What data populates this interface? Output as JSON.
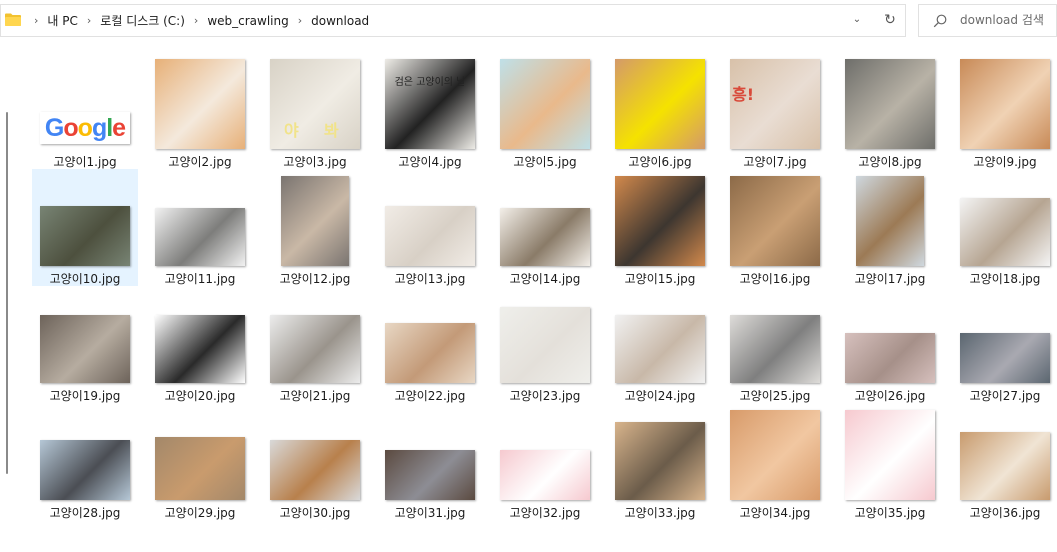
{
  "address": {
    "breadcrumb": [
      "내 PC",
      "로컬 디스크 (C:)",
      "web_crawling",
      "download"
    ]
  },
  "search": {
    "placeholder": "download 검색"
  },
  "files": [
    {
      "name": "고양이1.jpg",
      "kind": "google-logo",
      "logo_text": "Google"
    },
    {
      "name": "고양이2.jpg",
      "colors": [
        "#e7b078",
        "#f4e9dc"
      ]
    },
    {
      "name": "고양이3.jpg",
      "colors": [
        "#d8d2c6",
        "#f0ece4"
      ],
      "overlay": [
        "야",
        "봐"
      ]
    },
    {
      "name": "고양이4.jpg",
      "colors": [
        "#eeece7",
        "#222222"
      ],
      "book_title": "검은 고양이의 날"
    },
    {
      "name": "고양이5.jpg",
      "colors": [
        "#bfe0e8",
        "#e9b98b"
      ]
    },
    {
      "name": "고양이6.jpg",
      "colors": [
        "#d49a69",
        "#f5e200"
      ]
    },
    {
      "name": "고양이7.jpg",
      "colors": [
        "#d8c1a9",
        "#e9ddd3"
      ],
      "overlay": [
        "흥!"
      ]
    },
    {
      "name": "고양이8.jpg",
      "colors": [
        "#6e6e6a",
        "#b8b2a6"
      ]
    },
    {
      "name": "고양이9.jpg",
      "colors": [
        "#c88a57",
        "#f0d2b4"
      ]
    },
    {
      "name": "고양이10.jpg",
      "colors": [
        "#788474",
        "#4d503e"
      ],
      "selected": true
    },
    {
      "name": "고양이11.jpg",
      "colors": [
        "#f2f2f2",
        "#7d7d7b"
      ]
    },
    {
      "name": "고양이12.jpg",
      "colors": [
        "#7a7470",
        "#c9b8a6"
      ]
    },
    {
      "name": "고양이13.jpg",
      "colors": [
        "#f1ece6",
        "#d8d0c6"
      ]
    },
    {
      "name": "고양이14.jpg",
      "colors": [
        "#f3efe9",
        "#8a7b68"
      ]
    },
    {
      "name": "고양이15.jpg",
      "colors": [
        "#d2894c",
        "#3d3630"
      ]
    },
    {
      "name": "고양이16.jpg",
      "colors": [
        "#8c6a48",
        "#c99f74"
      ]
    },
    {
      "name": "고양이17.jpg",
      "colors": [
        "#cfd8df",
        "#9c7a55"
      ]
    },
    {
      "name": "고양이18.jpg",
      "colors": [
        "#f4f4f4",
        "#b6a592"
      ]
    },
    {
      "name": "고양이19.jpg",
      "colors": [
        "#6d635a",
        "#b6aca0"
      ]
    },
    {
      "name": "고양이20.jpg",
      "colors": [
        "#ffffff",
        "#2a2a2a"
      ]
    },
    {
      "name": "고양이21.jpg",
      "colors": [
        "#ececec",
        "#9a948c"
      ]
    },
    {
      "name": "고양이22.jpg",
      "colors": [
        "#e8d7c4",
        "#c39a78"
      ]
    },
    {
      "name": "고양이23.jpg",
      "colors": [
        "#efefeb",
        "#e4e0da"
      ]
    },
    {
      "name": "고양이24.jpg",
      "colors": [
        "#f1f1f1",
        "#c8b8a8"
      ]
    },
    {
      "name": "고양이25.jpg",
      "colors": [
        "#dedcd9",
        "#7f7f7f"
      ]
    },
    {
      "name": "고양이26.jpg",
      "colors": [
        "#d6c0bd",
        "#a69089"
      ]
    },
    {
      "name": "고양이27.jpg",
      "colors": [
        "#5b6670",
        "#a9a9b1"
      ]
    },
    {
      "name": "고양이28.jpg",
      "colors": [
        "#b5c7d6",
        "#4b4e54"
      ]
    },
    {
      "name": "고양이29.jpg",
      "colors": [
        "#a3886a",
        "#c99b6d"
      ]
    },
    {
      "name": "고양이30.jpg",
      "colors": [
        "#d9d9d9",
        "#b8804c"
      ]
    },
    {
      "name": "고양이31.jpg",
      "colors": [
        "#5b4a40",
        "#8d8d94"
      ]
    },
    {
      "name": "고양이32.jpg",
      "colors": [
        "#f6c9cf",
        "#ffffff"
      ]
    },
    {
      "name": "고양이33.jpg",
      "colors": [
        "#d8b48c",
        "#6b5c4a"
      ]
    },
    {
      "name": "고양이34.jpg",
      "colors": [
        "#d89b6a",
        "#f1c7a1"
      ]
    },
    {
      "name": "고양이35.jpg",
      "colors": [
        "#f6c9cf",
        "#ffffff"
      ]
    },
    {
      "name": "고양이36.jpg",
      "colors": [
        "#c89b6e",
        "#f0e4d4"
      ]
    }
  ]
}
